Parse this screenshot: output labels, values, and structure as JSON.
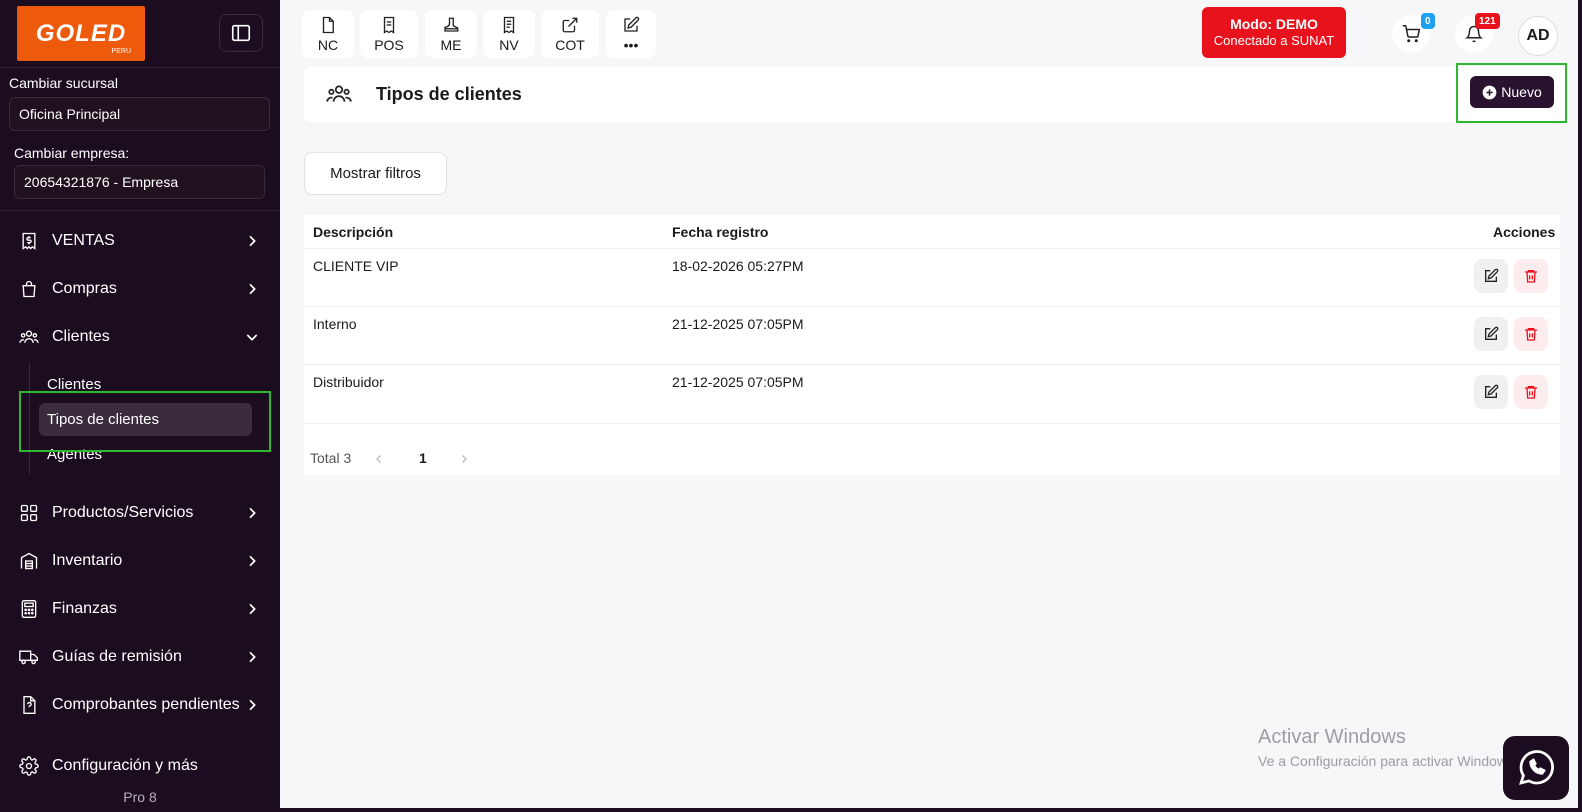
{
  "brand": {
    "logo_text": "GOLED",
    "logo_sub": "PERU"
  },
  "sidebar": {
    "branch_label": "Cambiar sucursal",
    "branch_value": "Oficina Principal",
    "company_label": "Cambiar empresa:",
    "company_value": "20654321876 - Empresa",
    "items": [
      {
        "label": "VENTAS"
      },
      {
        "label": "Compras"
      },
      {
        "label": "Clientes"
      },
      {
        "label": "Productos/Servicios"
      },
      {
        "label": "Inventario"
      },
      {
        "label": "Finanzas"
      },
      {
        "label": "Guías de remisión"
      },
      {
        "label": "Comprobantes pendientes"
      },
      {
        "label": "Configuración y más"
      }
    ],
    "sub_items": [
      {
        "label": "Clientes"
      },
      {
        "label": "Tipos de clientes"
      },
      {
        "label": "Agentes"
      }
    ],
    "version": "Pro 8"
  },
  "topbar": {
    "quick": [
      {
        "label": "NC"
      },
      {
        "label": "POS"
      },
      {
        "label": "ME"
      },
      {
        "label": "NV"
      },
      {
        "label": "COT"
      },
      {
        "label": "•••"
      }
    ],
    "mode_title": "Modo: DEMO",
    "mode_sub": "Conectado a SUNAT",
    "cart_badge": "0",
    "notif_badge": "121",
    "avatar": "AD"
  },
  "page": {
    "title": "Tipos de clientes",
    "new_button": "Nuevo",
    "filter_button": "Mostrar filtros"
  },
  "table": {
    "headers": {
      "description": "Descripción",
      "date": "Fecha registro",
      "actions": "Acciones"
    },
    "rows": [
      {
        "description": "CLIENTE VIP",
        "date": "18-02-2026 05:27PM"
      },
      {
        "description": "Interno",
        "date": "21-12-2025 07:05PM"
      },
      {
        "description": "Distribuidor",
        "date": "21-12-2025 07:05PM"
      }
    ],
    "total": "Total 3",
    "page": "1"
  },
  "watermark": {
    "line1": "Activar Windows",
    "line2": "Ve a Configuración para activar Windows."
  },
  "colors": {
    "sidebar_bg": "#1c0c1f",
    "accent": "#2a1330",
    "mode_red": "#e8121c",
    "logo_orange": "#ee5a0c",
    "highlight": "#2db82d"
  }
}
